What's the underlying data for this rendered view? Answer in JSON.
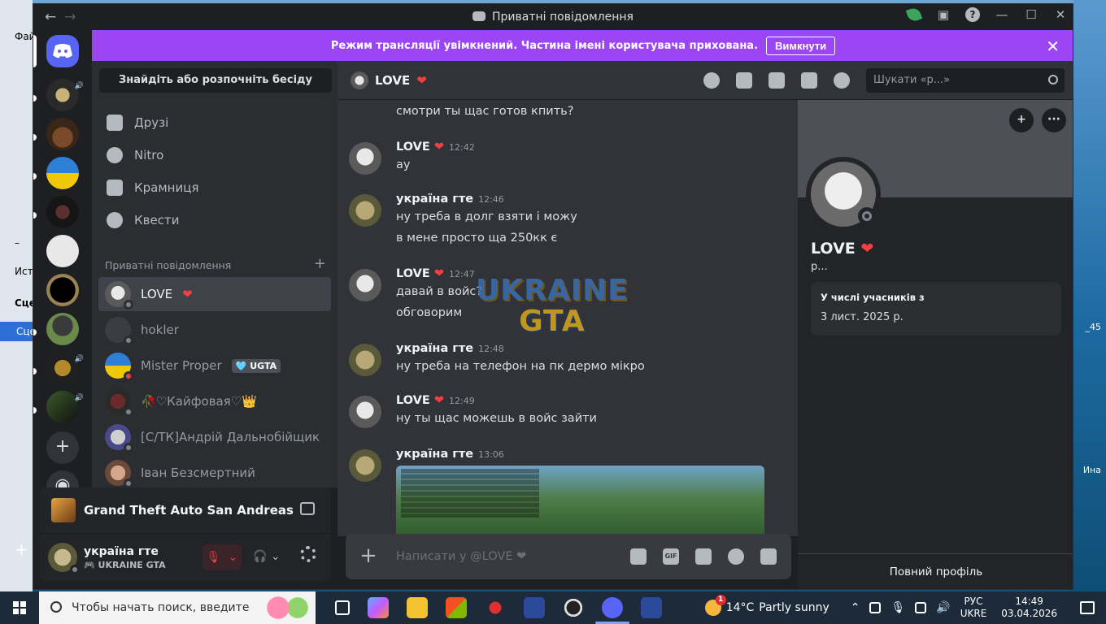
{
  "desktop": {
    "left_labels": [
      "Фай",
      "–",
      "Ист",
      "Сце",
      "Сце",
      "+"
    ],
    "right_labels": [
      "_45",
      "Ина"
    ]
  },
  "window": {
    "title": "Приватні повідомлення"
  },
  "banner": {
    "text": "Режим трансляції увімкнений. Частина імені користувача прихована.",
    "button": "Вимкнути"
  },
  "dm_sidebar": {
    "search": "Знайдіть або розпочніть бесіду",
    "nav": [
      {
        "label": "Друзі",
        "icon": "friends-icon"
      },
      {
        "label": "Nitro",
        "icon": "nitro-icon"
      },
      {
        "label": "Крамниця",
        "icon": "shop-icon"
      },
      {
        "label": "Квести",
        "icon": "quests-icon"
      }
    ],
    "section_title": "Приватні повідомлення",
    "dms": [
      {
        "name": "LOVE",
        "heart": "❤",
        "status": "offline"
      },
      {
        "name": "hokler",
        "status": "offline"
      },
      {
        "name": "Mister Proper",
        "tag": "🩵 UGTA",
        "status": "dnd"
      },
      {
        "name": "🥀♡Кайфовая♡👑",
        "status": "offline"
      },
      {
        "name": "[С/ТК]Андрій Дальнобійщик",
        "status": "offline"
      },
      {
        "name": "Іван Безсмертний",
        "status": "offline"
      }
    ]
  },
  "game_activity": {
    "title": "Grand Theft Auto San Andreas"
  },
  "user_panel": {
    "name": "україна гте",
    "sub": "UKRAINE GTA"
  },
  "chat_header": {
    "name": "LOVE",
    "heart": "❤",
    "search_placeholder": "Шукати «р...»"
  },
  "messages": [
    {
      "author": "",
      "time": "",
      "lines": [
        "смотри ты щас готов кпить?"
      ]
    },
    {
      "author": "LOVE ❤",
      "time": "12:42",
      "lines": [
        "ау"
      ]
    },
    {
      "author": "україна гте",
      "time": "12:46",
      "lines": [
        "ну треба в долг взяти і можу",
        "в мене просто ща 250кк є"
      ]
    },
    {
      "author": "LOVE ❤",
      "time": "12:47",
      "lines": [
        "давай в войс?",
        "обговорим"
      ]
    },
    {
      "author": "україна гте",
      "time": "12:48",
      "lines": [
        "ну треба на телефон на пк дермо мікро"
      ]
    },
    {
      "author": "LOVE ❤",
      "time": "12:49",
      "lines": [
        "ну ты щас можешь в войс зайти"
      ]
    },
    {
      "author": "україна гте",
      "time": "13:06",
      "lines": []
    }
  ],
  "watermark": {
    "line1": "UKRAINE",
    "line2": "GTA"
  },
  "composer": {
    "placeholder": "Написати у @LOVE ❤",
    "gif": "GIF"
  },
  "profile": {
    "name": "LOVE",
    "heart": "❤",
    "username": "р...",
    "member_since_title": "У числі учасників з",
    "member_since": "3 лист. 2025 р.",
    "full_profile": "Повний профіль"
  },
  "taskbar": {
    "search_placeholder": "Чтобы начать поиск, введите",
    "weather_temp": "14°C",
    "weather_desc": "Partly sunny",
    "weather_badge": "1",
    "lang_top": "РУС",
    "lang_bottom": "UKRE",
    "time": "14:49",
    "date": "03.04.2026"
  },
  "colors": {
    "banner": "#9b45f4",
    "discord_blurple": "#5865f2",
    "heart": "#f23f43"
  }
}
